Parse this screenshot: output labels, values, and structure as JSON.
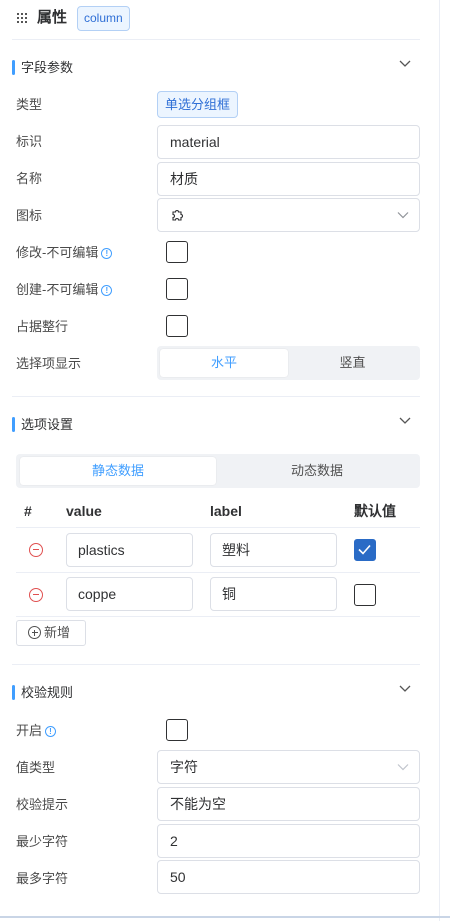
{
  "header": {
    "title": "属性",
    "tag": "column"
  },
  "section_fields": {
    "title": "字段参数",
    "type": {
      "label": "类型",
      "value": "单选分组框"
    },
    "key": {
      "label": "标识",
      "value": "material"
    },
    "name": {
      "label": "名称",
      "value": "材质"
    },
    "icon": {
      "label": "图标",
      "selected_icon": "puzzle-icon"
    },
    "edit_readonly": {
      "label": "修改-不可编辑",
      "checked": false
    },
    "create_readonly": {
      "label": "创建-不可编辑",
      "checked": false
    },
    "full_row": {
      "label": "占据整行",
      "checked": false
    },
    "display": {
      "label": "选择项显示",
      "options": [
        "水平",
        "竖直"
      ],
      "selected": "水平"
    }
  },
  "section_options": {
    "title": "选项设置",
    "tabs": [
      "静态数据",
      "动态数据"
    ],
    "active_tab": "静态数据",
    "columns": [
      "#",
      "value",
      "label",
      "默认值"
    ],
    "rows": [
      {
        "value": "plastics",
        "label": "塑料",
        "default": true
      },
      {
        "value": "coppe",
        "label": "铜",
        "default": false
      }
    ],
    "add_label": "新增"
  },
  "section_validation": {
    "title": "校验规则",
    "enable": {
      "label": "开启",
      "checked": false
    },
    "value_type": {
      "label": "值类型",
      "value": "字符"
    },
    "hint": {
      "label": "校验提示",
      "value": "不能为空"
    },
    "min_chars": {
      "label": "最少字符",
      "value": "2"
    },
    "max_chars": {
      "label": "最多字符",
      "value": "50"
    }
  },
  "colors": {
    "accent": "#409eff",
    "checked": "#2a6bc6",
    "danger": "#e05050"
  }
}
